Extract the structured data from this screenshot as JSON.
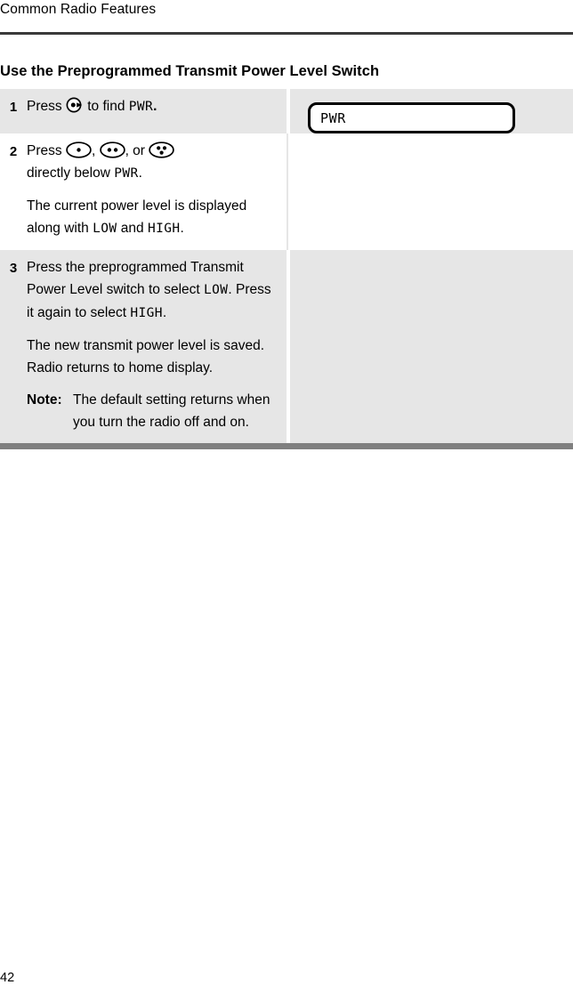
{
  "header": {
    "running_title": "Common Radio Features"
  },
  "section": {
    "title": "Use the Preprogrammed Transmit Power Level Switch"
  },
  "procedure": {
    "rows": [
      {
        "number": "1",
        "shaded": true,
        "text_before_icon": "Press ",
        "icon": "menu-select-button-icon",
        "text_after_icon": " to find ",
        "lcd_word": "PWR",
        "text_end": ".",
        "display": {
          "present": true,
          "lcd_text": "PWR"
        }
      },
      {
        "number": "2",
        "shaded": false,
        "line1_prefix": "Press ",
        "icons": [
          "one-dot-button-icon",
          "two-dot-button-icon",
          "three-dot-button-icon"
        ],
        "icon_sep1": ", ",
        "icon_sep2": ", or ",
        "line2_prefix": "directly below ",
        "line2_lcd": "PWR",
        "line2_end": ".",
        "para2_part1": "The current power level is displayed along with ",
        "para2_lcd1": "LOW",
        "para2_part2": " and ",
        "para2_lcd2": "HIGH",
        "para2_end": ".",
        "display": {
          "present": false
        }
      },
      {
        "number": "3",
        "shaded": true,
        "para1_part1": "Press the preprogrammed Transmit Power Level switch to select ",
        "para1_lcd1": "LOW",
        "para1_part2": ". Press it again to select ",
        "para1_lcd2": "HIGH",
        "para1_end": ".",
        "para2": "The new transmit power level is saved. Radio returns to home display.",
        "note_label": "Note:",
        "note_text": "The default setting returns when you turn the radio off and on.",
        "display": {
          "present": false
        }
      }
    ]
  },
  "footer": {
    "page_number": "42"
  },
  "colors": {
    "shaded_row": "#e6e6e6",
    "plain_row": "#ffffff",
    "header_rule": "#3a3a3a",
    "footer_bar": "#808080",
    "text": "#000000"
  }
}
